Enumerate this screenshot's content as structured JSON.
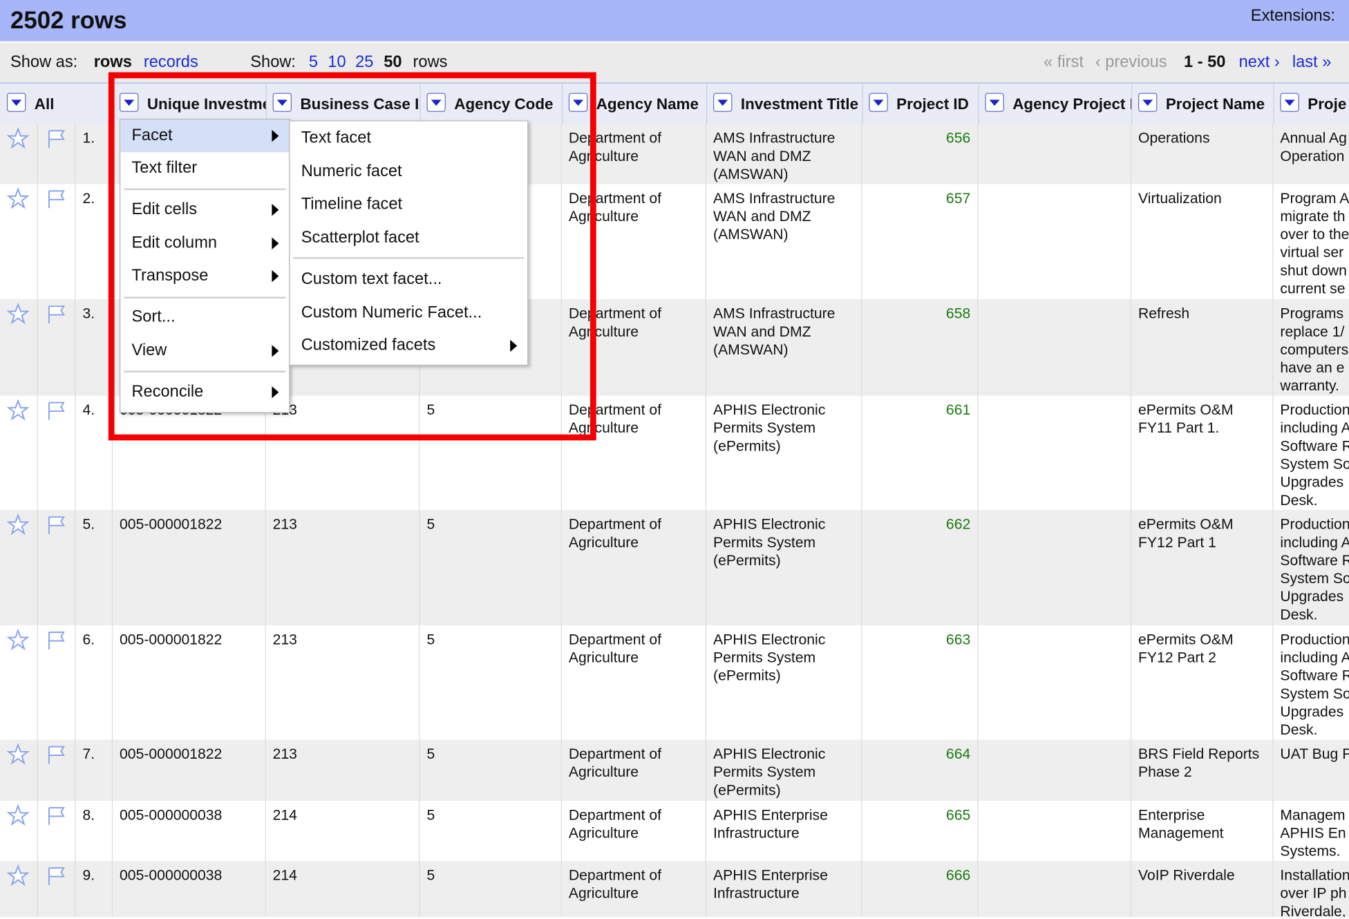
{
  "header": {
    "row_count": "2502 rows",
    "extensions": "Extensions:"
  },
  "view": {
    "show_as_label": "Show as:",
    "rows_option": "rows",
    "records_option": "records",
    "show_label": "Show:",
    "page_sizes": [
      "5",
      "10",
      "25"
    ],
    "current_page_size": "50",
    "rows_suffix": "rows"
  },
  "pagination": {
    "first": "« first",
    "previous": "‹ previous",
    "range": "1 - 50",
    "next": "next ›",
    "last": "last »"
  },
  "columns": [
    "All",
    "Unique Investme",
    "Business Case I",
    "Agency Code",
    "Agency Name",
    "Investment Title",
    "Project ID",
    "Agency Project I",
    "Project Name",
    "Proje"
  ],
  "rows": [
    {
      "n": "1.",
      "uid": "",
      "bc": "",
      "ac": "",
      "agency": "Department of Agriculture",
      "title": "AMS Infrastructure WAN and DMZ (AMSWAN)",
      "pid": "656",
      "apid": "",
      "pname": "Operations",
      "desc": "Annual Ag\nOperation"
    },
    {
      "n": "2.",
      "uid": "",
      "bc": "",
      "ac": "",
      "agency": "Department of Agriculture",
      "title": "AMS Infrastructure WAN and DMZ (AMSWAN)",
      "pid": "657",
      "apid": "",
      "pname": "Virtualization",
      "desc": "Program A\nmigrate th\nover to the\nvirtual ser\nshut down\ncurrent se"
    },
    {
      "n": "3.",
      "uid": "",
      "bc": "",
      "ac": "",
      "agency": "Department of Agriculture",
      "title": "AMS Infrastructure WAN and DMZ (AMSWAN)",
      "pid": "658",
      "apid": "",
      "pname": "Refresh",
      "desc": "Programs\nreplace 1/\ncomputers\nhave an e\nwarranty."
    },
    {
      "n": "4.",
      "uid": "005-000001822",
      "bc": "213",
      "ac": "5",
      "agency": "Department of Agriculture",
      "title": "APHIS Electronic Permits System (ePermits)",
      "pid": "661",
      "apid": "",
      "pname": "ePermits O&M FY11 Part 1.",
      "desc": "Production\nincluding A\nSoftware R\nSystem So\nUpgrades\nDesk."
    },
    {
      "n": "5.",
      "uid": "005-000001822",
      "bc": "213",
      "ac": "5",
      "agency": "Department of Agriculture",
      "title": "APHIS Electronic Permits System (ePermits)",
      "pid": "662",
      "apid": "",
      "pname": "ePermits O&M FY12 Part 1",
      "desc": "Production\nincluding A\nSoftware R\nSystem So\nUpgrades\nDesk."
    },
    {
      "n": "6.",
      "uid": "005-000001822",
      "bc": "213",
      "ac": "5",
      "agency": "Department of Agriculture",
      "title": "APHIS Electronic Permits System (ePermits)",
      "pid": "663",
      "apid": "",
      "pname": "ePermits O&M FY12 Part 2",
      "desc": "Production\nincluding A\nSoftware R\nSystem So\nUpgrades\nDesk."
    },
    {
      "n": "7.",
      "uid": "005-000001822",
      "bc": "213",
      "ac": "5",
      "agency": "Department of Agriculture",
      "title": "APHIS Electronic Permits System (ePermits)",
      "pid": "664",
      "apid": "",
      "pname": "BRS Field Reports Phase 2",
      "desc": "UAT Bug F"
    },
    {
      "n": "8.",
      "uid": "005-000000038",
      "bc": "214",
      "ac": "5",
      "agency": "Department of Agriculture",
      "title": "APHIS Enterprise Infrastructure",
      "pid": "665",
      "apid": "",
      "pname": "Enterprise Management",
      "desc": "Managem\nAPHIS En\nSystems."
    },
    {
      "n": "9.",
      "uid": "005-000000038",
      "bc": "214",
      "ac": "5",
      "agency": "Department of Agriculture",
      "title": "APHIS Enterprise Infrastructure",
      "pid": "666",
      "apid": "",
      "pname": "VoIP Riverdale",
      "desc": "Installation\nover IP ph\nRiverdale,"
    }
  ],
  "column_menu": [
    "Facet",
    "Text filter",
    "Edit cells",
    "Edit column",
    "Transpose",
    "Sort...",
    "View",
    "Reconcile"
  ],
  "facet_submenu": [
    "Text facet",
    "Numeric facet",
    "Timeline facet",
    "Scatterplot facet",
    "Custom text facet...",
    "Custom Numeric Facet...",
    "Customized facets"
  ],
  "colors": {
    "header_bg": "#a6b6f8",
    "link": "#1b2cd6",
    "project_id": "#1a7a10",
    "highlight_box": "#f50000"
  }
}
